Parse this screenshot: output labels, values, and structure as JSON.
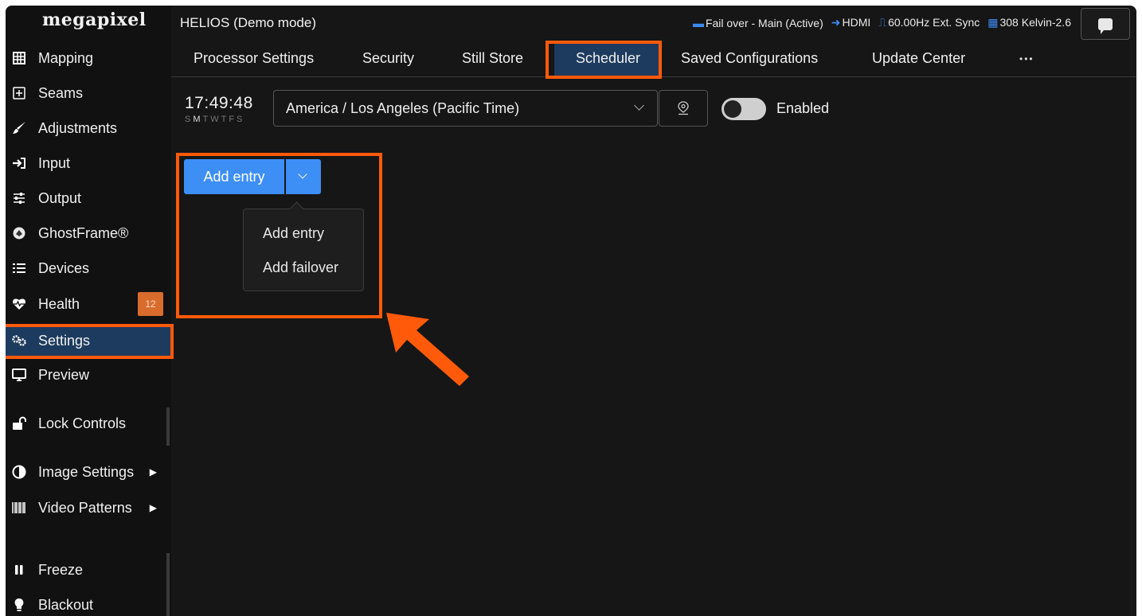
{
  "app": {
    "logo": "megapixel",
    "title": "HELIOS (Demo mode)"
  },
  "status": {
    "failover": "Fail over - Main (Active)",
    "input": "HDMI",
    "sync": "60.00Hz Ext. Sync",
    "output": "308 Kelvin-2.6"
  },
  "sidebar": {
    "items": [
      {
        "label": "Mapping",
        "icon": "grid-icon"
      },
      {
        "label": "Seams",
        "icon": "plus-square-icon"
      },
      {
        "label": "Adjustments",
        "icon": "brush-icon"
      },
      {
        "label": "Input",
        "icon": "sign-in-icon"
      },
      {
        "label": "Output",
        "icon": "sliders-icon"
      },
      {
        "label": "GhostFrame®",
        "icon": "ghostframe-icon"
      },
      {
        "label": "Devices",
        "icon": "list-icon"
      },
      {
        "label": "Health",
        "icon": "heartbeat-icon",
        "badge": "12"
      },
      {
        "label": "Settings",
        "icon": "gears-icon"
      },
      {
        "label": "Preview",
        "icon": "monitor-icon"
      },
      {
        "label": "Lock Controls",
        "icon": "unlock-icon"
      },
      {
        "label": "Image Settings",
        "icon": "contrast-icon"
      },
      {
        "label": "Video Patterns",
        "icon": "barcode-icon"
      },
      {
        "label": "Freeze",
        "icon": "pause-icon"
      },
      {
        "label": "Blackout",
        "icon": "bulb-icon"
      }
    ]
  },
  "tabs": [
    "Processor Settings",
    "Security",
    "Still Store",
    "Scheduler",
    "Saved Configurations",
    "Update Center"
  ],
  "tabs_more": "•••",
  "scheduler": {
    "time": "17:49:48",
    "days_first": "S",
    "days_active": "M",
    "days_rest": "TWTFS",
    "timezone": "America / Los Angeles (Pacific Time)",
    "enabled_label": "Enabled",
    "add_button": "Add entry",
    "menu": [
      "Add entry",
      "Add failover"
    ]
  },
  "colors": {
    "accent": "#3d8ef5",
    "active_nav": "#1d3b5e",
    "highlight": "#ff5a0a",
    "badge": "#d96c2c"
  }
}
